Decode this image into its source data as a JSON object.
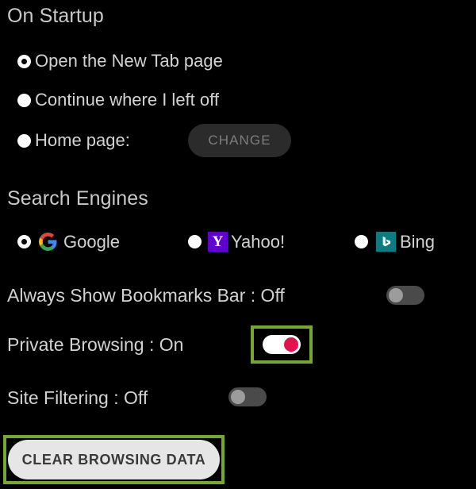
{
  "page": {
    "background_color": "#000000",
    "text_color": "#c9c9c9",
    "highlight_color": "#76a82c",
    "accent_on_color": "#e3114c"
  },
  "startup": {
    "title": "On Startup",
    "options": [
      {
        "label": "Open the New Tab page",
        "selected": true
      },
      {
        "label": "Continue where I left off",
        "selected": false
      },
      {
        "label": "Home page:",
        "selected": false
      }
    ],
    "change_button": {
      "label": "CHANGE",
      "enabled": false
    }
  },
  "search_engines": {
    "title": "Search Engines",
    "options": [
      {
        "label": "Google",
        "icon": "google-logo-icon",
        "selected": true
      },
      {
        "label": "Yahoo!",
        "icon": "yahoo-logo-icon",
        "selected": false,
        "icon_color": "#6001d2",
        "icon_glyph": "Y"
      },
      {
        "label": "Bing",
        "icon": "bing-logo-icon",
        "selected": false,
        "icon_color": "#0d7b7f"
      }
    ]
  },
  "settings": [
    {
      "label": "Always Show Bookmarks Bar  : Off",
      "name": "always-show-bookmarks-bar",
      "state": "Off",
      "highlighted": false
    },
    {
      "label": "Private Browsing  : On",
      "name": "private-browsing",
      "state": "On",
      "highlighted": true
    },
    {
      "label": "Site Filtering  : Off",
      "name": "site-filtering",
      "state": "Off",
      "highlighted": false
    }
  ],
  "clear_button": {
    "label": "CLEAR BROWSING DATA",
    "highlighted": true
  }
}
